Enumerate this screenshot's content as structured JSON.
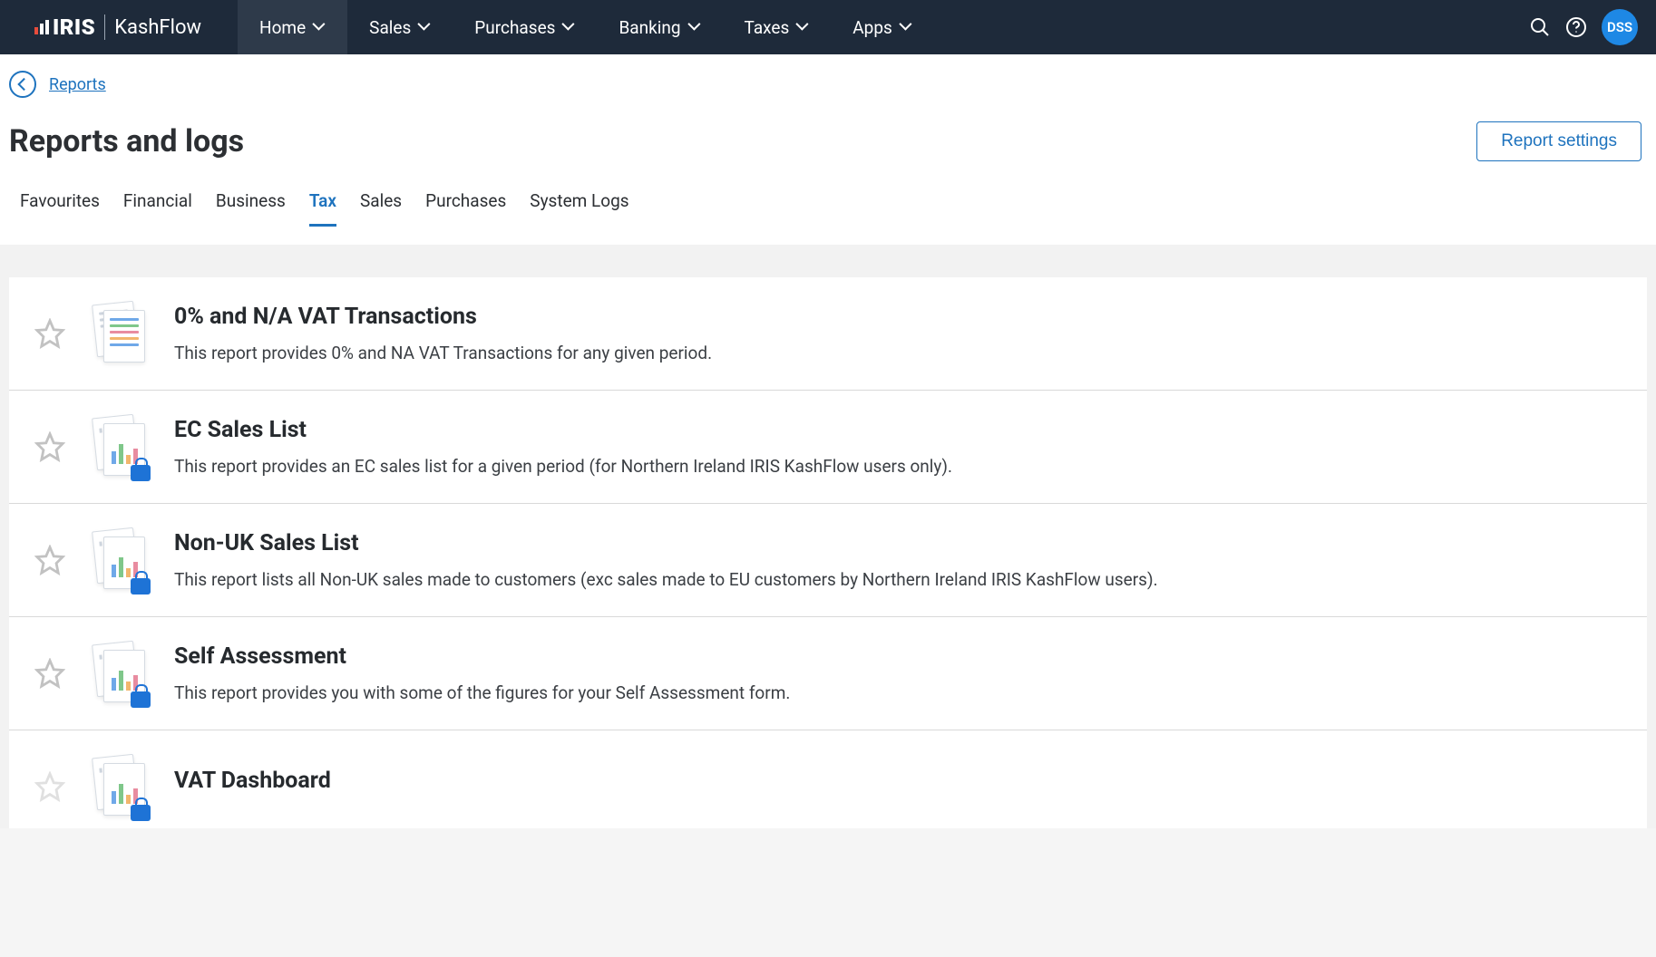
{
  "logo": {
    "iris": "IRIS",
    "product": "KashFlow"
  },
  "nav": {
    "items": [
      {
        "label": "Home",
        "active": true
      },
      {
        "label": "Sales"
      },
      {
        "label": "Purchases"
      },
      {
        "label": "Banking"
      },
      {
        "label": "Taxes"
      },
      {
        "label": "Apps"
      }
    ]
  },
  "avatar": "DSS",
  "breadcrumb": {
    "label": "Reports"
  },
  "page_title": "Reports and logs",
  "settings_button": "Report settings",
  "tabs": [
    {
      "label": "Favourites"
    },
    {
      "label": "Financial"
    },
    {
      "label": "Business"
    },
    {
      "label": "Tax",
      "active": true
    },
    {
      "label": "Sales"
    },
    {
      "label": "Purchases"
    },
    {
      "label": "System Logs"
    }
  ],
  "reports": [
    {
      "title": "0% and N/A VAT Transactions",
      "desc": "This report provides 0% and NA VAT Transactions for any given period.",
      "icon": "doc-lines"
    },
    {
      "title": "EC Sales List",
      "desc": "This report provides an EC sales list for a given period (for Northern Ireland IRIS KashFlow users only).",
      "icon": "doc-lock"
    },
    {
      "title": "Non-UK Sales List",
      "desc": "This report lists all Non-UK sales made to customers (exc sales made to EU customers by Northern Ireland IRIS KashFlow users).",
      "icon": "doc-lock"
    },
    {
      "title": "Self Assessment",
      "desc": "This report provides you with some of the figures for your Self Assessment form.",
      "icon": "doc-lock"
    },
    {
      "title": "VAT Dashboard",
      "desc": "",
      "icon": "doc-lock"
    }
  ]
}
